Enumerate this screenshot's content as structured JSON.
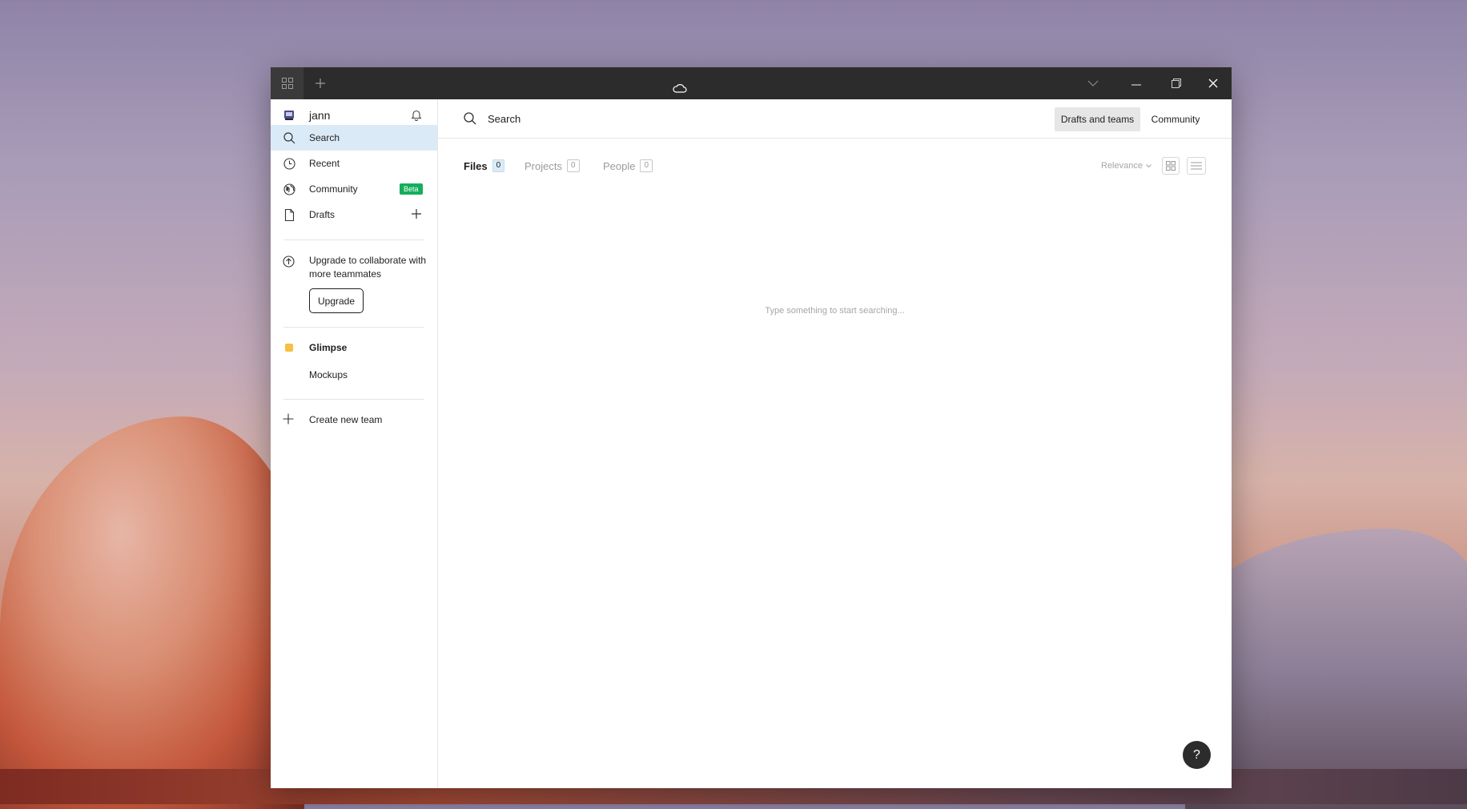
{
  "titlebar": {
    "icons": [
      "grid-icon",
      "plus-icon",
      "cloud-icon",
      "chevron-down-icon",
      "minimize-icon",
      "restore-icon",
      "close-icon"
    ]
  },
  "sidebar": {
    "user": {
      "name": "jann"
    },
    "items": [
      {
        "label": "Search",
        "icon": "search-icon",
        "active": true
      },
      {
        "label": "Recent",
        "icon": "clock-icon"
      },
      {
        "label": "Community",
        "icon": "globe-icon",
        "badge": "Beta"
      },
      {
        "label": "Drafts",
        "icon": "file-icon"
      }
    ],
    "upgrade": {
      "text": "Upgrade to collaborate with more teammates",
      "button_label": "Upgrade"
    },
    "team": {
      "name": "Glimpse",
      "color": "#F6C042",
      "projects": [
        "Mockups"
      ]
    },
    "create_team_label": "Create new team"
  },
  "search": {
    "placeholder": "Search",
    "scope_buttons": [
      "Drafts and teams",
      "Community"
    ]
  },
  "tabs": [
    {
      "label": "Files",
      "count": "0"
    },
    {
      "label": "Projects",
      "count": "0"
    },
    {
      "label": "People",
      "count": "0"
    }
  ],
  "sort": {
    "label": "Relevance"
  },
  "empty_state": "Type something to start searching...",
  "help": {
    "label": "?"
  },
  "colors": {
    "accent_active_bg": "#DAEBF7",
    "beta_badge": "#14AE5C",
    "titlebar": "#2C2C2C"
  }
}
